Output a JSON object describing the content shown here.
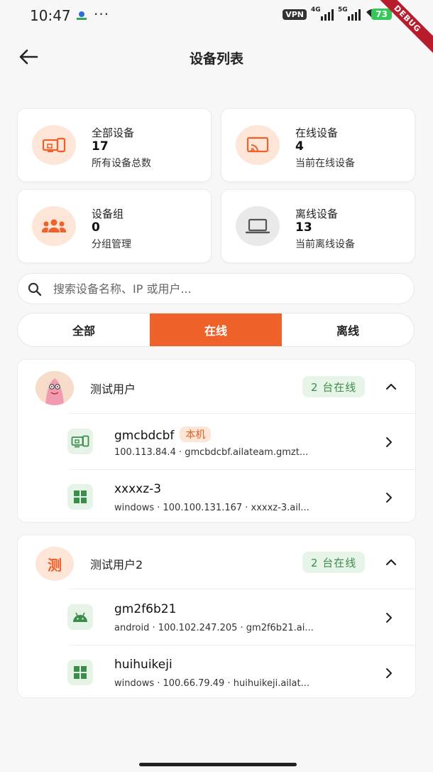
{
  "status_bar": {
    "time": "10:47",
    "dots": "···",
    "vpn": "VPN",
    "sig1_label": "4G",
    "sig2_label": "5G",
    "battery": "73",
    "debug": "DEBUG"
  },
  "header": {
    "title": "设备列表",
    "back_icon": "arrow-left-icon"
  },
  "stats": [
    {
      "label": "全部设备",
      "value": "17",
      "desc": "所有设备总数",
      "icon": "devices-icon"
    },
    {
      "label": "在线设备",
      "value": "4",
      "desc": "当前在线设备",
      "icon": "cast-icon"
    },
    {
      "label": "设备组",
      "value": "0",
      "desc": "分组管理",
      "icon": "group-icon"
    },
    {
      "label": "离线设备",
      "value": "13",
      "desc": "当前离线设备",
      "icon": "laptop-icon"
    }
  ],
  "search": {
    "placeholder": "搜索设备名称、IP 或用户..."
  },
  "tabs": [
    {
      "label": "全部",
      "active": false
    },
    {
      "label": "在线",
      "active": true
    },
    {
      "label": "离线",
      "active": false
    }
  ],
  "groups": [
    {
      "name": "测试用户",
      "avatar_type": "image",
      "online_badge": "2 台在线",
      "devices": [
        {
          "name": "gmcbdcbf",
          "tag": "本机",
          "meta": "100.113.84.4 · gmcbdcbf.ailateam.gmzt...",
          "icon": "devices-icon"
        },
        {
          "name": "xxxxz-3",
          "meta": "windows · 100.100.131.167 · xxxxz-3.ail...",
          "icon": "windows-icon"
        }
      ]
    },
    {
      "name": "测试用户2",
      "avatar_text": "测",
      "online_badge": "2 台在线",
      "devices": [
        {
          "name": "gm2f6b21",
          "meta": "android · 100.102.247.205 · gm2f6b21.ai...",
          "icon": "android-icon"
        },
        {
          "name": "huihuikeji",
          "meta": "windows · 100.66.79.49 · huihuikeji.ailat...",
          "icon": "windows-icon"
        }
      ]
    }
  ],
  "colors": {
    "accent": "#ee6129",
    "online_green": "#3c8d4c",
    "online_bg": "#e7f4e8",
    "accent_bg": "#fde5d8"
  }
}
